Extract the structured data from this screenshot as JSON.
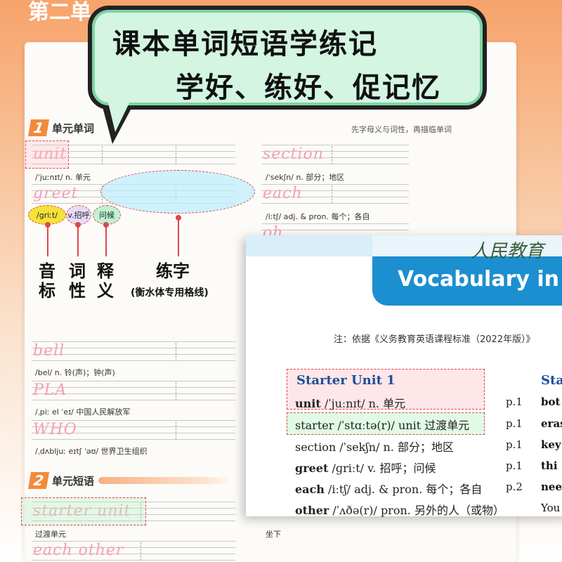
{
  "unit_header": "第二单",
  "bubble": {
    "line1": "课本单词短语学练记",
    "line2": "学好、练好、促记忆"
  },
  "page_note": "先字母义与词性，再描临单词",
  "section1": {
    "num": "1",
    "title": "单元单词"
  },
  "section2": {
    "num": "2",
    "title": "单元短语"
  },
  "words_left": [
    {
      "word": "unit",
      "def": "/ˈjuːnɪt/ n. 单元"
    },
    {
      "word": "greet",
      "def": ""
    },
    {
      "word": "bell",
      "def": "/bel/ n. 铃(声)；钟(声)"
    },
    {
      "word": "PLA",
      "def": "/ˌpiː el ˈeɪ/ 中国人民解放军"
    },
    {
      "word": "WHO",
      "def": "/ˌdʌbljuː eɪtʃ ˈəʊ/ 世界卫生组织"
    }
  ],
  "words_right": [
    {
      "word": "section",
      "def": "/ˈsekʃn/ n. 部分；地区"
    },
    {
      "word": "each",
      "def": "/iːtʃ/ adj. & pron. 每个；各自"
    },
    {
      "word": "oh",
      "def": ""
    }
  ],
  "greet_parts": {
    "phonetic": "/ɡriːt/",
    "pos": "v.",
    "meaning1": "招呼",
    "meaning2": "问候"
  },
  "callouts": {
    "phonetic": "音标",
    "pos": "词性",
    "meaning": "释义",
    "practice": "练字",
    "practice_sub": "(衡水体专用格线)"
  },
  "phrases": [
    {
      "phrase": "starter unit",
      "def": "过渡单元"
    },
    {
      "phrase": "each other",
      "def": ""
    }
  ],
  "phrase_right_def": "坐下",
  "card": {
    "script": "人民教育",
    "title": "Vocabulary in I",
    "note": "注：依据《义务教育英语课程标准（2022年版）》",
    "unit_heading": "Starter Unit 1",
    "right_heading": "Sta",
    "entries": [
      {
        "head": "unit",
        "rest": " /ˈjuːnɪt/ n. 单元",
        "page": "",
        "bold": true
      },
      {
        "head": "starter /ˈstɑːtə(r)/ unit 过渡单元",
        "rest": "",
        "page": "p.1",
        "bold": false
      },
      {
        "head": "section",
        "rest": " /ˈsekʃn/ n. 部分；地区",
        "page": "p.1",
        "bold": false
      },
      {
        "head": "greet",
        "rest": " /ɡriːt/ v. 招呼；问候",
        "page": "p.1",
        "bold": true
      },
      {
        "head": "each",
        "rest": " /iːtʃ/ adj. & pron. 每个；各自",
        "page": "p.2",
        "bold": true
      },
      {
        "head": "other",
        "rest": " /ˈʌðə(r)/ pron. 另外的人（或物）",
        "page": "",
        "bold": true
      }
    ],
    "first_page": "p.1",
    "right_col": [
      "bot",
      "eras",
      "key",
      "thi",
      "nee",
      "You"
    ]
  }
}
